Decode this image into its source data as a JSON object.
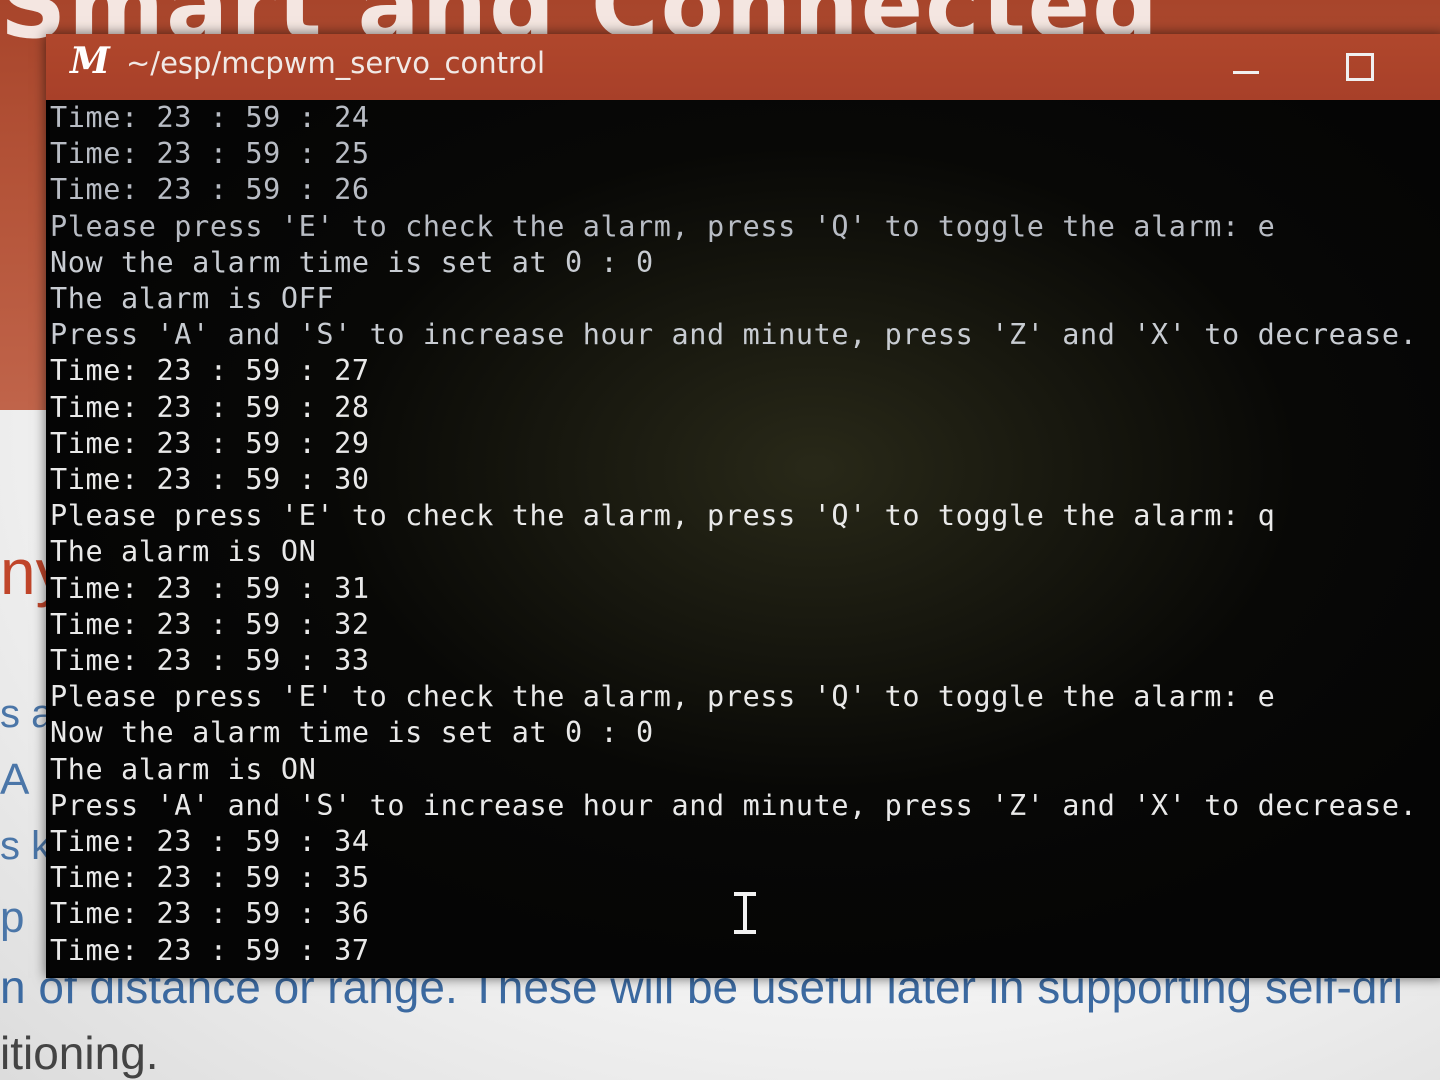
{
  "window": {
    "app_icon": "mintty-icon",
    "title": "~/esp/mcpwm_servo_control",
    "minimize_icon": "minimize-icon",
    "maximize_icon": "maximize-icon"
  },
  "console": {
    "lines": [
      "Time: 23 : 59 : 24",
      "Time: 23 : 59 : 25",
      "Time: 23 : 59 : 26",
      "Please press 'E' to check the alarm, press 'Q' to toggle the alarm: e",
      "Now the alarm time is set at 0 : 0",
      "The alarm is OFF",
      "Press 'A' and 'S' to increase hour and minute, press 'Z' and 'X' to decrease.",
      "Time: 23 : 59 : 27",
      "Time: 23 : 59 : 28",
      "Time: 23 : 59 : 29",
      "Time: 23 : 59 : 30",
      "Please press 'E' to check the alarm, press 'Q' to toggle the alarm: q",
      "The alarm is ON",
      "Time: 23 : 59 : 31",
      "Time: 23 : 59 : 32",
      "Time: 23 : 59 : 33",
      "Please press 'E' to check the alarm, press 'Q' to toggle the alarm: e",
      "Now the alarm time is set at 0 : 0",
      "The alarm is ON",
      "Press 'A' and 'S' to increase hour and minute, press 'Z' and 'X' to decrease.",
      "Time: 23 : 59 : 34",
      "Time: 23 : 59 : 35",
      "Time: 23 : 59 : 36",
      "Time: 23 : 59 : 37"
    ]
  },
  "background_page": {
    "headline": "Smart and Connected",
    "left_fragments": [
      "ny",
      "s a",
      "A",
      "s k",
      "p"
    ],
    "bottom_line_1": "n of distance or range. These will be useful later in supporting self-dri",
    "bottom_line_2": "itioning."
  },
  "colors": {
    "titlebar": "#a84029",
    "console_bg": "#050505",
    "console_text": "#e9e9e9"
  }
}
